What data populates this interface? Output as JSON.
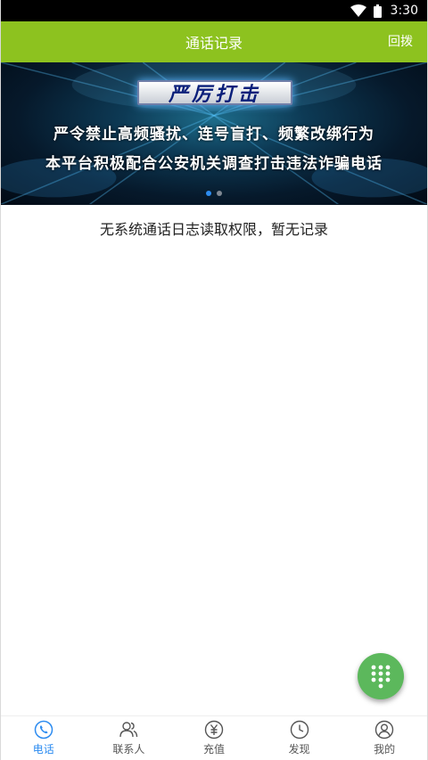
{
  "status_bar": {
    "time": "3:30",
    "icons": [
      "wifi-icon",
      "battery-icon"
    ]
  },
  "header": {
    "title": "通话记录",
    "action_label": "回拨"
  },
  "banner": {
    "badge": "严厉打击",
    "line1": "严令禁止高频骚扰、连号盲打、频繁改绑行为",
    "line2": "本平台积极配合公安机关调查打击违法诈骗电话",
    "slides_total": 2,
    "active_slide": 1
  },
  "empty_message": "无系统通话日志读取权限，暂无记录",
  "fab": {
    "icon": "dialpad-icon",
    "color": "#5cb85c"
  },
  "tabs": [
    {
      "label": "电话",
      "icon": "phone-icon",
      "active": true
    },
    {
      "label": "联系人",
      "icon": "contacts-icon",
      "active": false
    },
    {
      "label": "充值",
      "icon": "yuan-icon",
      "active": false
    },
    {
      "label": "发现",
      "icon": "clock-icon",
      "active": false
    },
    {
      "label": "我的",
      "icon": "user-icon",
      "active": false
    }
  ],
  "colors": {
    "header": "#8dc21f",
    "tab_active": "#2d8cf0",
    "tab_inactive": "#555555"
  }
}
